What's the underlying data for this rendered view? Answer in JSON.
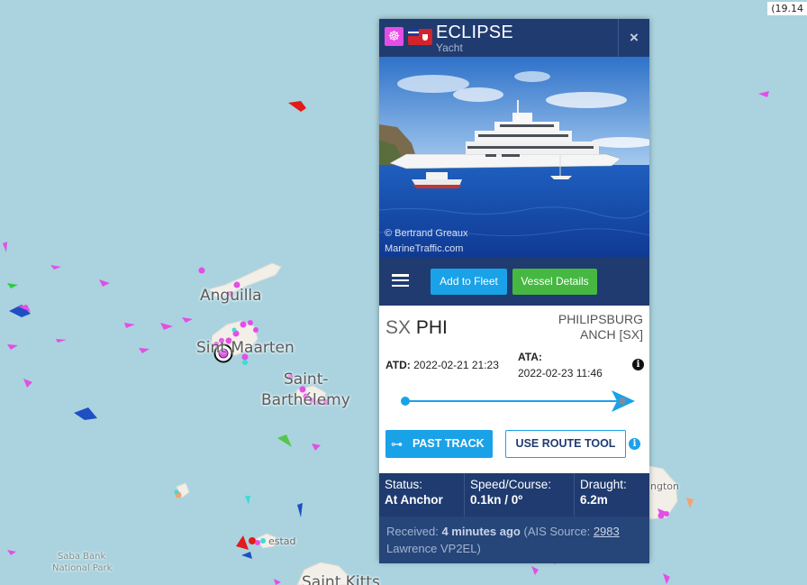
{
  "map": {
    "coordinate_readout": "(19.14",
    "labels": {
      "anguilla": "Anguilla",
      "sint_maarten": "Sint Maarten",
      "saint_barthelemy_1": "Saint-",
      "saint_barthelemy_2": "Barthélemy",
      "saba_bank_1": "Saba Bank",
      "saba_bank_2": "National Park",
      "saint_kitts": "Saint Kitts",
      "oranjestad": "estad",
      "codrington": "ngton"
    }
  },
  "popup": {
    "vessel_name": "ECLIPSE",
    "vessel_type": "Yacht",
    "close_label": "×",
    "photo_credit_1": "© Bertrand Greaux",
    "photo_credit_2": "MarineTraffic.com",
    "add_fleet_label": "Add to Fleet",
    "vessel_details_label": "Vessel Details",
    "departure_code_prefix": "SX",
    "departure_code": "PHI",
    "arrival_line_1": "PHILIPSBURG",
    "arrival_line_2": "ANCH [SX]",
    "atd_label": "ATD:",
    "atd_value": "2022-02-21 21:23",
    "ata_label": "ATA:",
    "ata_value": "2022-02-23 11:46",
    "past_track_label": "PAST TRACK",
    "route_tool_label": "USE ROUTE TOOL",
    "status_label": "Status:",
    "status_value": "At Anchor",
    "speed_label": "Speed/Course:",
    "speed_value": "0.1kn / 0º",
    "draught_label": "Draught:",
    "draught_value": "6.2m",
    "received_prefix": "Received:",
    "received_value": "4 minutes ago",
    "ais_prefix": "(AIS Source:",
    "ais_id": "2983",
    "ais_name": "Lawrence VP2EL)"
  },
  "colors": {
    "header": "#1f3b70",
    "accent_blue": "#1aa2e8",
    "accent_green": "#46b842",
    "yacht_magenta": "#e64de6"
  }
}
